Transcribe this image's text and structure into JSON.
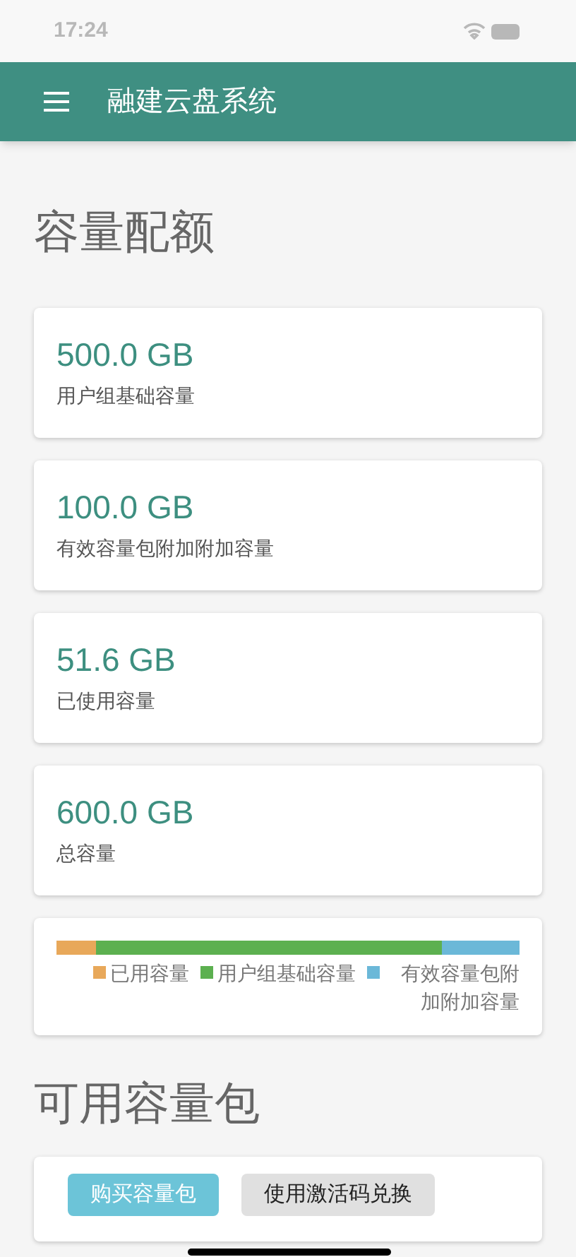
{
  "status_bar": {
    "time": "17:24"
  },
  "app_bar": {
    "title": "融建云盘系统"
  },
  "quota_section": {
    "title": "容量配额",
    "cards": [
      {
        "value": "500.0 GB",
        "label": "用户组基础容量"
      },
      {
        "value": "100.0 GB",
        "label": "有效容量包附加附加容量"
      },
      {
        "value": "51.6 GB",
        "label": "已使用容量"
      },
      {
        "value": "600.0 GB",
        "label": "总容量"
      }
    ],
    "usage_bar": [
      {
        "label": "已用容量",
        "color": "#e8a85a",
        "level": 0.086
      },
      {
        "label": "用户组基础容量",
        "color": "#5cb050"
      },
      {
        "label": "有效容量包附加附加容量",
        "color": "#6bb8d8",
        "level": 0.167
      }
    ]
  },
  "packages_section": {
    "title": "可用容量包",
    "buttons": [
      {
        "label": "购买容量包",
        "kind": "primary"
      },
      {
        "label": "使用激活码兑换",
        "kind": "secondary"
      }
    ]
  }
}
